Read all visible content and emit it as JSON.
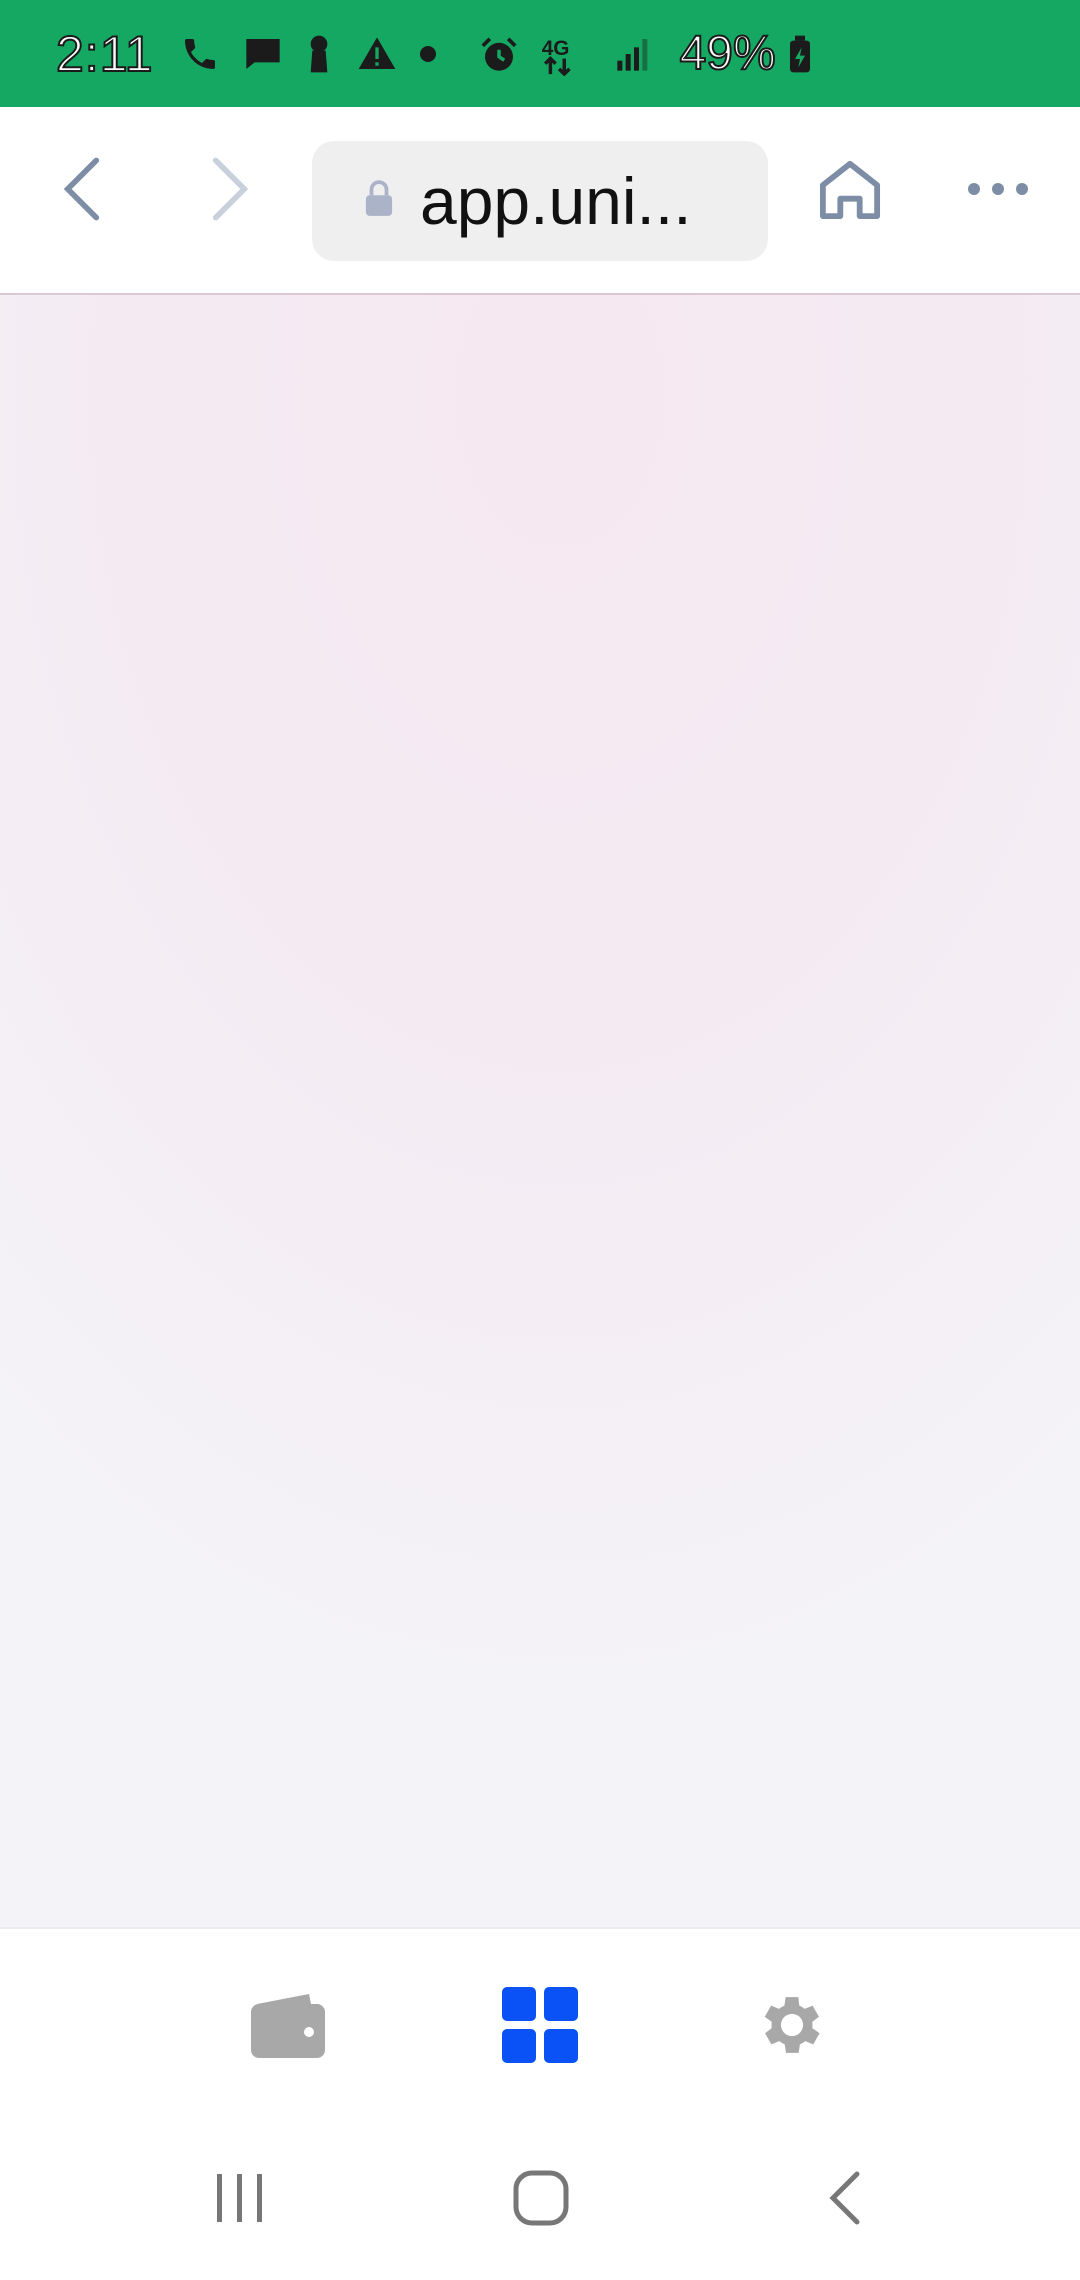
{
  "status_bar": {
    "time": "2:11",
    "battery": "49%",
    "network": "4G",
    "background": "#15a862",
    "icons": [
      "phone-icon",
      "message-icon",
      "keyhole-icon",
      "warning-icon",
      "dot-icon",
      "alarm-icon",
      "4g-lte-icon",
      "signal-icon",
      "battery-charging-icon"
    ]
  },
  "browser": {
    "url": "app.uni...",
    "buttons": [
      "back-icon",
      "forward-icon",
      "home-icon",
      "more-icon"
    ]
  },
  "bottom_tabs": {
    "active_color": "#0a52f5",
    "inactive_color": "#a8a8a8",
    "items": [
      {
        "icon": "wallet-icon",
        "active": false
      },
      {
        "icon": "grid-icon",
        "active": true
      },
      {
        "icon": "settings-icon",
        "active": false
      }
    ]
  },
  "system_nav": {
    "buttons": [
      "recents-icon",
      "home-circle-icon",
      "back-chevron-icon"
    ]
  }
}
